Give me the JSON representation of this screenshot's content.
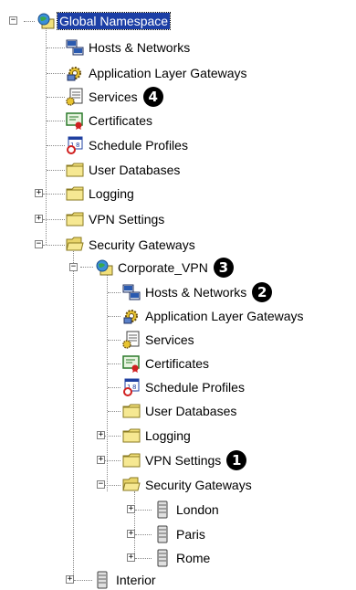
{
  "tree": {
    "root": {
      "label": "Global Namespace",
      "badge": ""
    },
    "global_children": [
      {
        "label": "Hosts & Networks",
        "icon": "hosts-networks-icon"
      },
      {
        "label": "Application Layer Gateways",
        "icon": "alg-icon"
      },
      {
        "label": "Services",
        "icon": "services-icon",
        "badge": "4"
      },
      {
        "label": "Certificates",
        "icon": "certificate-icon"
      },
      {
        "label": "Schedule Profiles",
        "icon": "schedule-icon"
      },
      {
        "label": "User Databases",
        "icon": "folder-icon"
      },
      {
        "label": "Logging",
        "icon": "folder-icon"
      },
      {
        "label": "VPN Settings",
        "icon": "folder-icon"
      },
      {
        "label": "Security Gateways",
        "icon": "folder-open-icon"
      }
    ],
    "corporate": {
      "label": "Corporate_VPN",
      "badge": "3"
    },
    "corporate_children": [
      {
        "label": "Hosts & Networks",
        "icon": "hosts-networks-icon",
        "badge": "2"
      },
      {
        "label": "Application Layer Gateways",
        "icon": "alg-icon"
      },
      {
        "label": "Services",
        "icon": "services-icon"
      },
      {
        "label": "Certificates",
        "icon": "certificate-icon"
      },
      {
        "label": "Schedule Profiles",
        "icon": "schedule-icon"
      },
      {
        "label": "User Databases",
        "icon": "folder-icon"
      },
      {
        "label": "Logging",
        "icon": "folder-icon"
      },
      {
        "label": "VPN Settings",
        "icon": "folder-icon",
        "badge": "1"
      },
      {
        "label": "Security Gateways",
        "icon": "folder-open-icon"
      }
    ],
    "gateways": [
      {
        "label": "London",
        "icon": "server-icon"
      },
      {
        "label": "Paris",
        "icon": "server-icon"
      },
      {
        "label": "Rome",
        "icon": "server-icon"
      }
    ],
    "interior": {
      "label": "Interior",
      "icon": "server-icon"
    },
    "colors": {
      "selection": "#1c3fa6",
      "folder": "#f2e07a",
      "badge": "#000000"
    }
  }
}
